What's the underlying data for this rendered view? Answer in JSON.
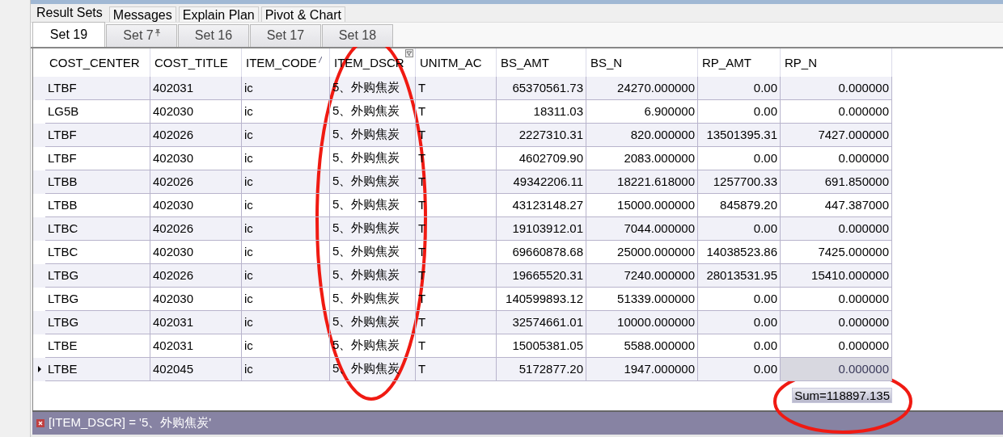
{
  "result_tabs": [
    {
      "label": "Result Sets",
      "selected": true
    },
    {
      "label": "Messages",
      "selected": false
    },
    {
      "label": "Explain Plan",
      "selected": false
    },
    {
      "label": "Pivot & Chart",
      "selected": false
    }
  ],
  "set_tabs": [
    {
      "label": "Set 19",
      "selected": true,
      "pinned": false
    },
    {
      "label": "Set 7",
      "selected": false,
      "pinned": true
    },
    {
      "label": "Set 16",
      "selected": false,
      "pinned": false
    },
    {
      "label": "Set 17",
      "selected": false,
      "pinned": false
    },
    {
      "label": "Set 18",
      "selected": false,
      "pinned": false
    }
  ],
  "table": {
    "columns": [
      {
        "label": "COST_CENTER",
        "kind": "text",
        "sorted": false,
        "filtered": false,
        "focused": false
      },
      {
        "label": "COST_TITLE",
        "kind": "text",
        "sorted": false,
        "filtered": false,
        "focused": false
      },
      {
        "label": "ITEM_CODE",
        "kind": "text",
        "sorted": true,
        "filtered": false,
        "focused": false
      },
      {
        "label": "ITEM_DSCR",
        "kind": "text",
        "sorted": false,
        "filtered": true,
        "focused": false
      },
      {
        "label": "UNITM_AC",
        "kind": "text",
        "sorted": false,
        "filtered": false,
        "focused": false
      },
      {
        "label": "BS_AMT",
        "kind": "number",
        "sorted": false,
        "filtered": false,
        "focused": false
      },
      {
        "label": "BS_N",
        "kind": "number",
        "sorted": false,
        "filtered": false,
        "focused": false
      },
      {
        "label": "RP_AMT",
        "kind": "number",
        "sorted": false,
        "filtered": false,
        "focused": false
      },
      {
        "label": "RP_N",
        "kind": "number",
        "sorted": false,
        "filtered": false,
        "focused": true
      }
    ],
    "rows": [
      {
        "selected": false,
        "cells": [
          "LTBF",
          "402031",
          "ic",
          "5、外购焦炭",
          "T",
          "65370561.73",
          "24270.000000",
          "0.00",
          "0.000000"
        ]
      },
      {
        "selected": false,
        "cells": [
          "LG5B",
          "402030",
          "ic",
          "5、外购焦炭",
          "T",
          "18311.03",
          "6.900000",
          "0.00",
          "0.000000"
        ]
      },
      {
        "selected": false,
        "cells": [
          "LTBF",
          "402026",
          "ic",
          "5、外购焦炭",
          "T",
          "2227310.31",
          "820.000000",
          "13501395.31",
          "7427.000000"
        ]
      },
      {
        "selected": false,
        "cells": [
          "LTBF",
          "402030",
          "ic",
          "5、外购焦炭",
          "T",
          "4602709.90",
          "2083.000000",
          "0.00",
          "0.000000"
        ]
      },
      {
        "selected": false,
        "cells": [
          "LTBB",
          "402026",
          "ic",
          "5、外购焦炭",
          "T",
          "49342206.11",
          "18221.618000",
          "1257700.33",
          "691.850000"
        ]
      },
      {
        "selected": false,
        "cells": [
          "LTBB",
          "402030",
          "ic",
          "5、外购焦炭",
          "T",
          "43123148.27",
          "15000.000000",
          "845879.20",
          "447.387000"
        ]
      },
      {
        "selected": false,
        "cells": [
          "LTBC",
          "402026",
          "ic",
          "5、外购焦炭",
          "T",
          "19103912.01",
          "7044.000000",
          "0.00",
          "0.000000"
        ]
      },
      {
        "selected": false,
        "cells": [
          "LTBC",
          "402030",
          "ic",
          "5、外购焦炭",
          "T",
          "69660878.68",
          "25000.000000",
          "14038523.86",
          "7425.000000"
        ]
      },
      {
        "selected": false,
        "cells": [
          "LTBG",
          "402026",
          "ic",
          "5、外购焦炭",
          "T",
          "19665520.31",
          "7240.000000",
          "28013531.95",
          "15410.000000"
        ]
      },
      {
        "selected": false,
        "cells": [
          "LTBG",
          "402030",
          "ic",
          "5、外购焦炭",
          "T",
          "140599893.12",
          "51339.000000",
          "0.00",
          "0.000000"
        ]
      },
      {
        "selected": false,
        "cells": [
          "LTBG",
          "402031",
          "ic",
          "5、外购焦炭",
          "T",
          "32574661.01",
          "10000.000000",
          "0.00",
          "0.000000"
        ]
      },
      {
        "selected": false,
        "cells": [
          "LTBE",
          "402031",
          "ic",
          "5、外购焦炭",
          "T",
          "15005381.05",
          "5588.000000",
          "0.00",
          "0.000000"
        ]
      },
      {
        "selected": true,
        "cells": [
          "LTBE",
          "402045",
          "ic",
          "5、外购焦炭",
          "T",
          "5172877.20",
          "1947.000000",
          "0.00",
          "0.000000"
        ]
      }
    ],
    "summary": "Sum=118897.135"
  },
  "filter_bar": {
    "text": "[ITEM_DSCR] = '5、外购焦炭'"
  }
}
